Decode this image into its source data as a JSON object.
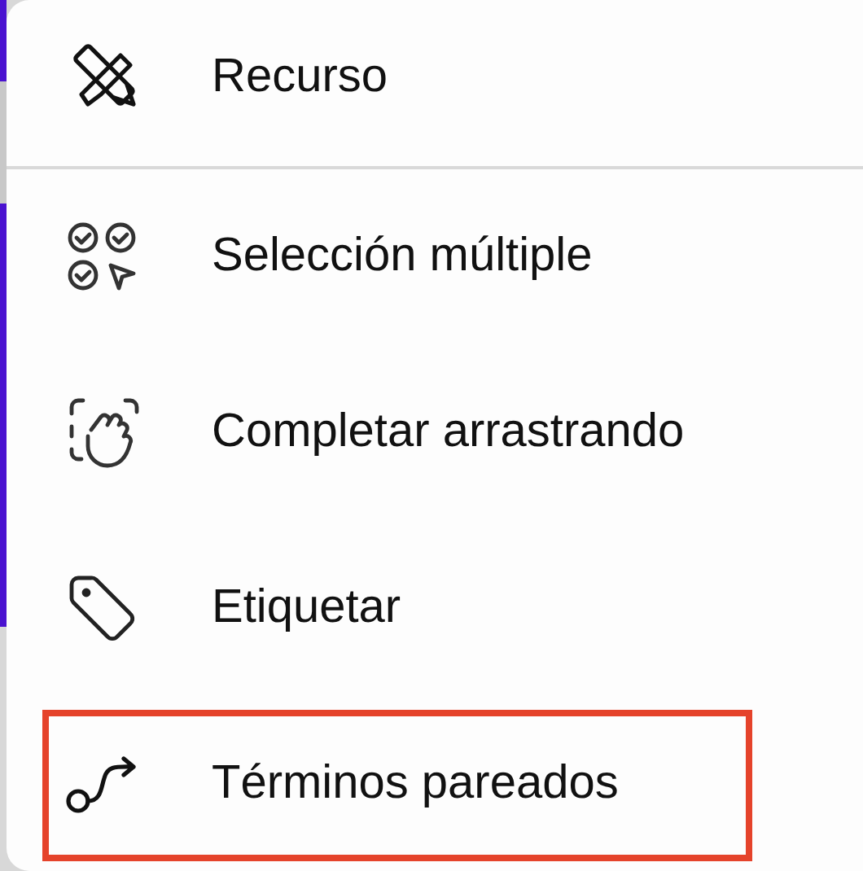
{
  "menu": {
    "sections": [
      {
        "items": [
          {
            "label": "Recurso",
            "selected": false
          }
        ]
      },
      {
        "items": [
          {
            "label": "Selección múltiple",
            "selected": false
          },
          {
            "label": "Completar arrastrando",
            "selected": false
          },
          {
            "label": "Etiquetar",
            "selected": false
          },
          {
            "label": "Términos pareados",
            "selected": true
          }
        ]
      }
    ]
  }
}
